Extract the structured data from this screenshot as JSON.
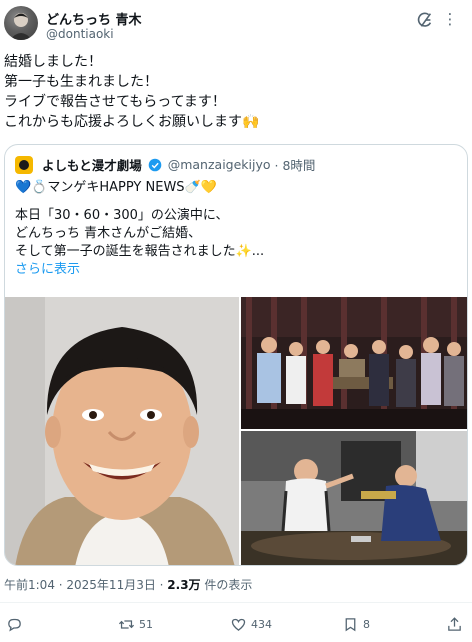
{
  "author": {
    "display_name": "どんちっち 青木",
    "handle": "@dontiaoki"
  },
  "tweet": {
    "lines": [
      "結婚しました！",
      "第一子も生まれました！",
      "ライブで報告させてもらってます！",
      "これからも応援よろしくお願いします🙌"
    ]
  },
  "quote": {
    "name": "よしもと漫才劇場",
    "handle": "@manzaigekijyo",
    "time": "· 8時間",
    "line1": "💙💍マンゲキHAPPY NEWS🍼💛",
    "line2": "本日「30・60・300」の公演中に、",
    "line3": "どんちっち 青木さんがご結婚、",
    "line4": "そして第一子の誕生を報告されました✨...",
    "show_more": "さらに表示"
  },
  "meta": {
    "time": "午前1:04 · 2025年11月3日 · ",
    "views": "2.3万",
    "views_suffix": " 件の表示"
  },
  "actions": {
    "reply_count": "",
    "retweet_count": "51",
    "like_count": "434",
    "bookmark_count": "8"
  },
  "icons": {
    "grok": "grok-icon",
    "more": "more-icon",
    "verified": "verified-badge-icon",
    "reply": "reply-icon",
    "retweet": "retweet-icon",
    "like": "like-icon",
    "bookmark": "bookmark-icon",
    "share": "share-icon"
  },
  "colors": {
    "text": "#0f1419",
    "secondary": "#536471",
    "link": "#1d9bf0",
    "border": "#cfd9de"
  }
}
